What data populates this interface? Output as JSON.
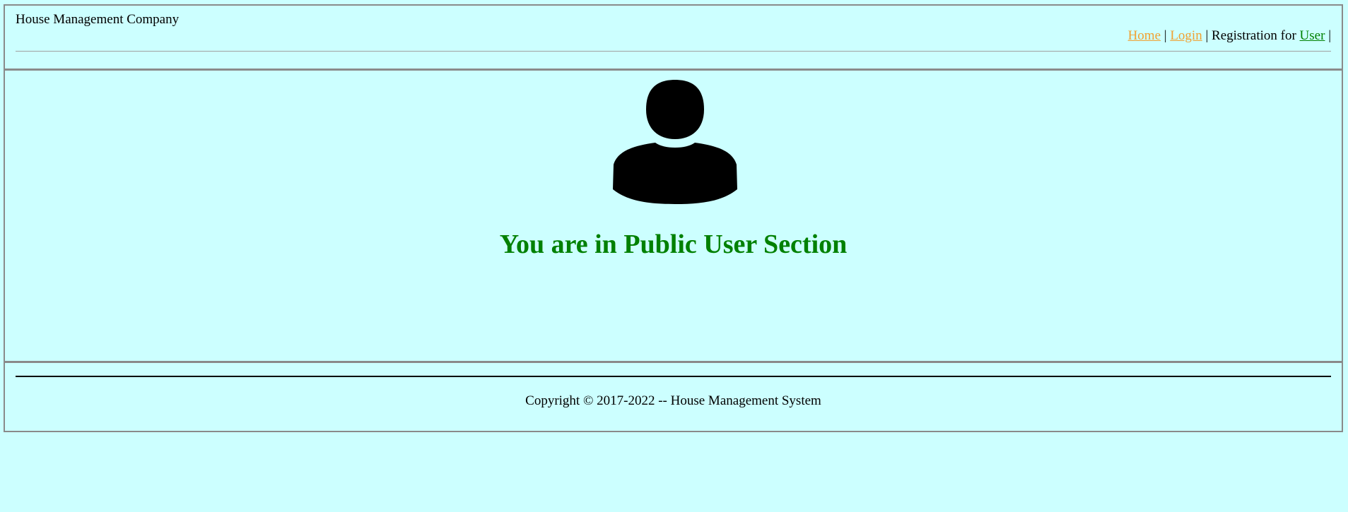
{
  "header": {
    "company_name": "House Management Company",
    "nav": {
      "home": "Home",
      "sep1": "|",
      "login": "Login",
      "sep2": "|",
      "registration_text": "Registration for",
      "user": "User",
      "sep3": "|"
    }
  },
  "main": {
    "icon": "user-silhouette-icon",
    "title": "You are in Public User Section"
  },
  "footer": {
    "copyright": "Copyright © 2017-2022 -- House Management System"
  },
  "colors": {
    "background": "#ccffff",
    "link_orange": "#f0a030",
    "link_green": "#008000",
    "title_green": "#008000"
  }
}
